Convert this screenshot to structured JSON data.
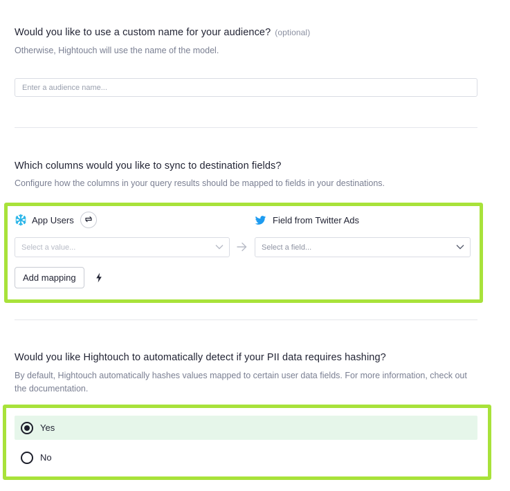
{
  "audience_name": {
    "question": "Would you like to use a custom name for your audience?",
    "optional": "(optional)",
    "description": "Otherwise, Hightouch will use the name of the model.",
    "placeholder": "Enter a audience name..."
  },
  "mapping": {
    "question": "Which columns would you like to sync to destination fields?",
    "description": "Configure how the columns in your query results should be mapped to fields in your destinations.",
    "source_label": "App Users",
    "source_icon": "snowflake-icon",
    "dest_label_prefix": "Field from",
    "dest_label_name": "Twitter Ads",
    "dest_icon": "twitter-icon",
    "source_placeholder": "Select a value...",
    "dest_placeholder": "Select a field...",
    "add_mapping_label": "Add mapping"
  },
  "hashing": {
    "question": "Would you like Hightouch to automatically detect if your PII data requires hashing?",
    "description": "By default, Hightouch automatically hashes values mapped to certain user data fields. For more information, check out the documentation.",
    "options": [
      {
        "label": "Yes",
        "selected": true
      },
      {
        "label": "No",
        "selected": false
      }
    ]
  },
  "colors": {
    "highlight": "#a8e23a",
    "snowflake": "#29b5e8",
    "twitter": "#1d9bf0",
    "selected_row": "#e6f6ea"
  }
}
